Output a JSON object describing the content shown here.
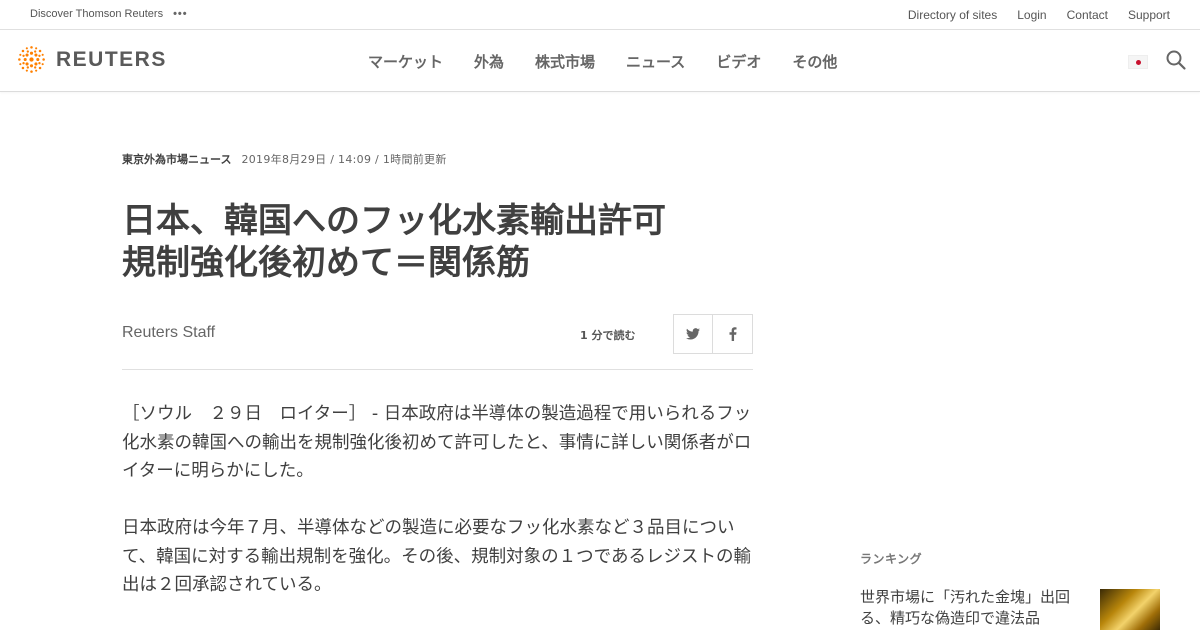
{
  "utility": {
    "discover": "Discover Thomson Reuters",
    "links": [
      "Directory of sites",
      "Login",
      "Contact",
      "Support"
    ]
  },
  "header": {
    "logo_text": "REUTERS",
    "nav": [
      "マーケット",
      "外為",
      "株式市場",
      "ニュース",
      "ビデオ",
      "その他"
    ],
    "search_icon": "search-icon",
    "flag_icon": "japan-flag-icon"
  },
  "article": {
    "section": "東京外為市場ニュース",
    "date": "2019年8月29日 / 14:09 / 1時間前更新",
    "headline_line1": "日本、韓国へのフッ化水素輸出許可",
    "headline_line2": "規制強化後初めて＝関係筋",
    "byline": "Reuters Staff",
    "read_time": "1 分で読む",
    "share_icons": [
      "twitter-icon",
      "facebook-icon"
    ],
    "paragraphs": [
      "［ソウル　２９日　ロイター］ - 日本政府は半導体の製造過程で用いられるフッ化水素の韓国への輸出を規制強化後初めて許可したと、事情に詳しい関係者がロイターに明らかにした。",
      "日本政府は今年７月、半導体などの製造に必要なフッ化水素など３品目について、韓国に対する輸出規制を強化。その後、規制対象の１つであるレジストの輸出は２回承認されている。"
    ]
  },
  "sidebar": {
    "ranking_label": "ランキング",
    "top_story": "世界市場に「汚れた金塊」出回る、精巧な偽造印で違法品"
  },
  "colors": {
    "logo_orange": "#ff8000",
    "text": "#404040"
  }
}
